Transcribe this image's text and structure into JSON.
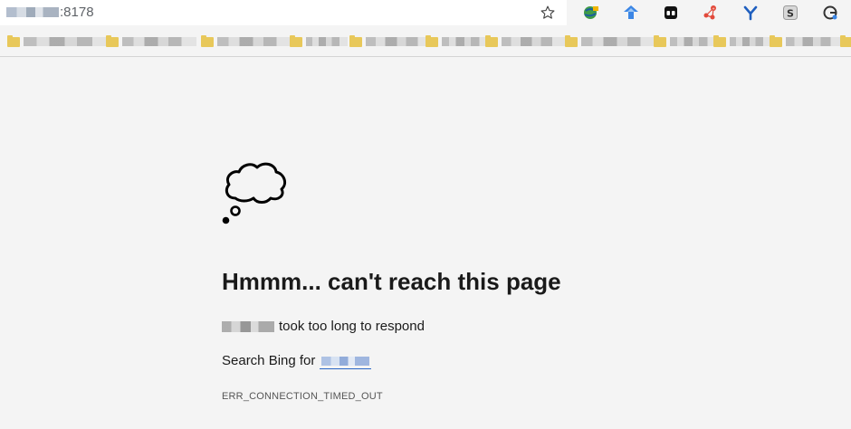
{
  "address_bar": {
    "url_suffix": ":8178"
  },
  "error": {
    "title": "Hmmm... can't reach this page",
    "description_suffix": "took too long to respond",
    "search_prefix": "Search Bing for",
    "code": "ERR_CONNECTION_TIMED_OUT"
  },
  "icons": {
    "star": "star-icon",
    "cloud": "thought-cloud-icon"
  },
  "colors": {
    "page_bg": "#f4f4f4",
    "link": "#2a66c5",
    "bookmark_folder": "#e8c85a"
  }
}
